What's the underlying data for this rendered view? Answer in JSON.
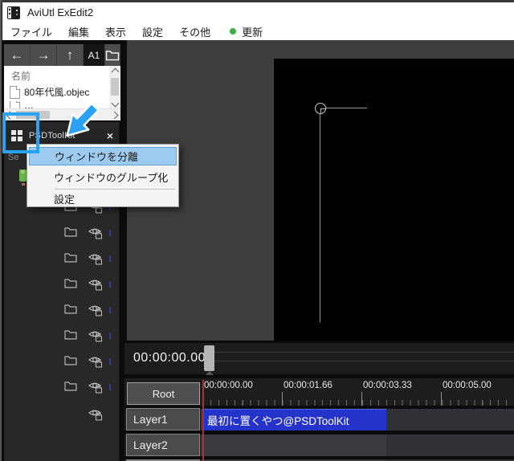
{
  "colors": {
    "annotation_blue": "#2aa2f2",
    "clip_blue": "#2433c9",
    "menu_highlight_blue": "#9dcbef",
    "update_green": "#3cb043",
    "playhead_red": "#a83434"
  },
  "titlebar": {
    "title": "AviUtl ExEdit2"
  },
  "menubar": {
    "items": [
      "ファイル",
      "編集",
      "表示",
      "設定",
      "その他"
    ],
    "update_label": "更新"
  },
  "toolbar": {
    "back": "←",
    "forward": "→",
    "up": "↑",
    "a1": "A1"
  },
  "file_panel": {
    "header": "名前",
    "items": [
      "80年代風.objec"
    ],
    "partial_item": "…"
  },
  "psd_panel": {
    "title": "PSDToolKit",
    "close": "×",
    "partial_label": "Se"
  },
  "context_menu": {
    "items": [
      "ウィンドウを分離",
      "ウィンドウのグループ化",
      "設定"
    ]
  },
  "scrubber": {
    "timecode": "00:00:00.00"
  },
  "timeline": {
    "root_label": "Root",
    "ruler_labels": [
      "00:00:00.00",
      "00:00:01.66",
      "00:00:03.33",
      "00:00:05.00"
    ],
    "layers": [
      "Layer1",
      "Layer2"
    ],
    "clip_label": "最初に置くやつ@PSDToolKit"
  }
}
